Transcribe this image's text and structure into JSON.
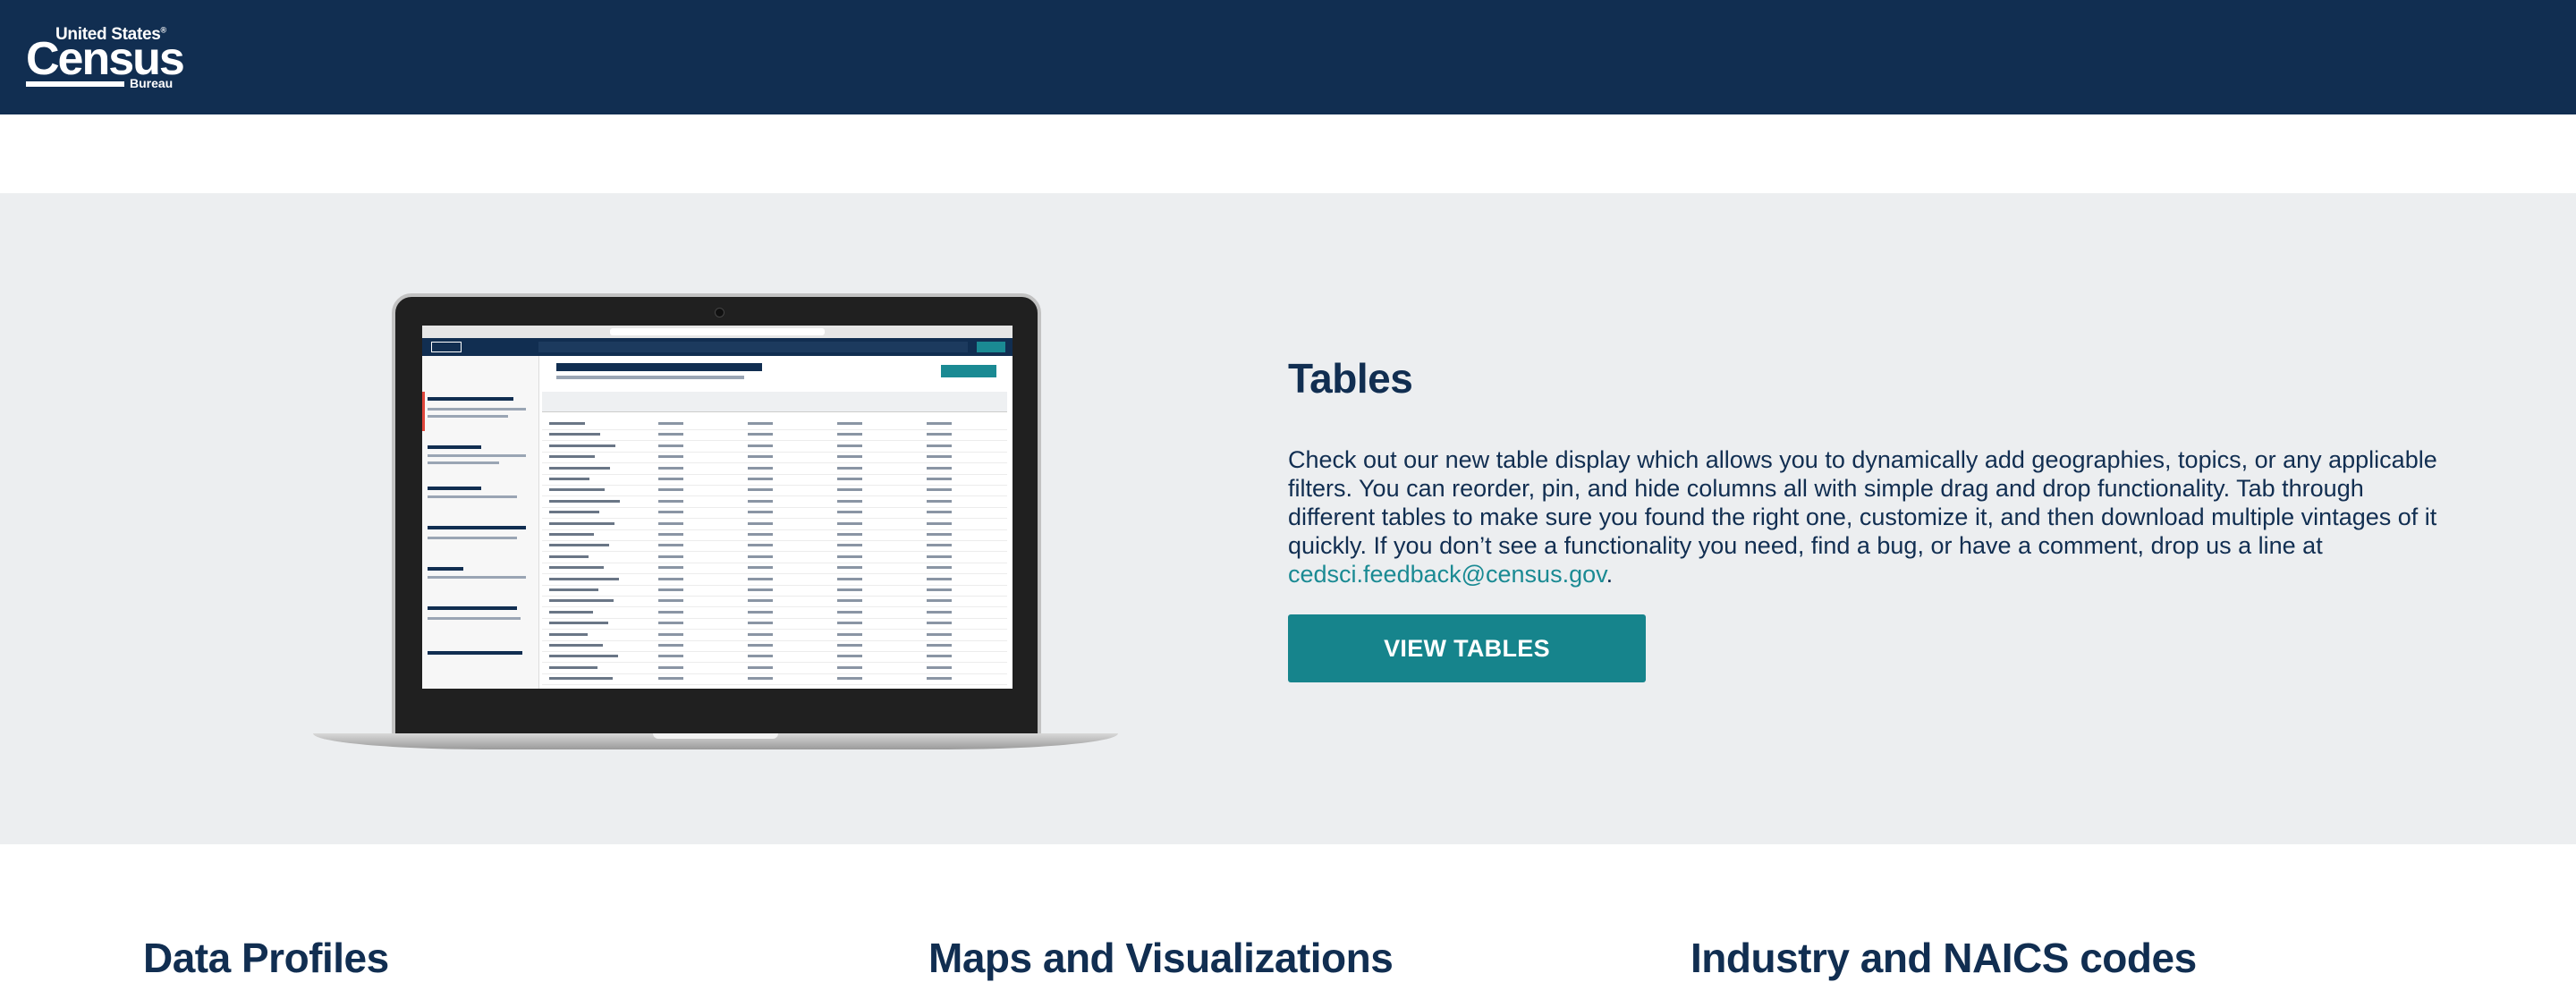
{
  "header": {
    "logo": {
      "country": "United States",
      "trademark": "®",
      "name": "Census",
      "sub": "Bureau"
    }
  },
  "feature": {
    "title": "Tables",
    "description": "Check out our new table display which allows you to dynamically add geographies, topics, or any applicable filters. You can reorder, pin, and hide columns all with simple drag and drop functionality. Tab through different tables to make sure you found the right one, customize it, and then download multiple vintages of it quickly. If you don’t see a functionality you need, find a bug, or have a comment, drop us a line at ",
    "email": "cedsci.feedback@census.gov",
    "trailing": ".",
    "button_label": "VIEW TABLES"
  },
  "sections": [
    {
      "title": "Data Profiles"
    },
    {
      "title": "Maps and Visualizations"
    },
    {
      "title": "Industry and NAICS codes"
    }
  ],
  "colors": {
    "navy": "#112e51",
    "teal": "#16848c",
    "feature_bg": "#eceef0"
  }
}
